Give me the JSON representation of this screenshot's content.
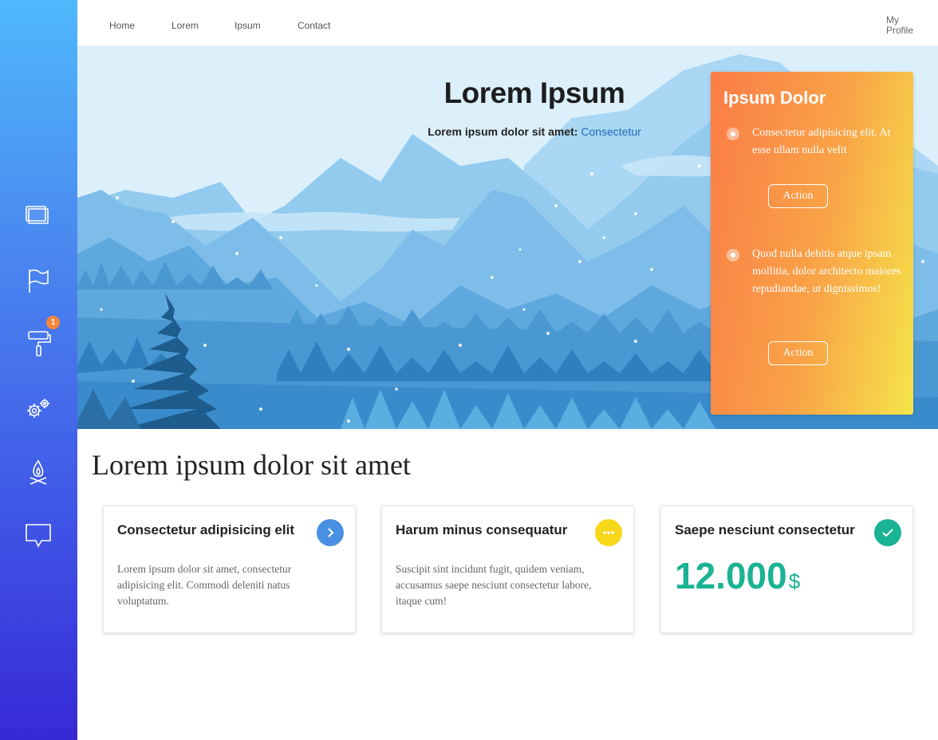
{
  "nav": {
    "links": [
      "Home",
      "Lorem",
      "Ipsum",
      "Contact"
    ],
    "profile": "My Profile"
  },
  "sidebar": {
    "items": [
      {
        "icon": "windows-icon"
      },
      {
        "icon": "flag-icon"
      },
      {
        "icon": "paint-roller-icon",
        "badge": "1"
      },
      {
        "icon": "gears-icon"
      },
      {
        "icon": "campfire-icon"
      },
      {
        "icon": "presentation-icon"
      }
    ]
  },
  "hero": {
    "title": "Lorem Ipsum",
    "subtitle_prefix": "Lorem ipsum dolor sit amet:",
    "subtitle_link": "Consectetur"
  },
  "panel": {
    "title": "Ipsum Dolor",
    "items": [
      {
        "text": "Consectetur adipisicing elit. At esse ullam nulla velit",
        "action": "Action"
      },
      {
        "text": "Quod nulla debitis atque ipsam mollitia, dolor architecto maiores repudiandae, ut dignissimos!",
        "action": "Action"
      }
    ]
  },
  "main": {
    "title": "Lorem ipsum dolor sit amet",
    "cards": [
      {
        "title": "Consectetur adipisicing elit",
        "icon": "chevron-right-icon",
        "color": "#4a90e2",
        "text": "Lorem ipsum dolor sit amet, consectetur adipisicing elit. Commodi deleniti natus voluptatum."
      },
      {
        "title": "Harum minus consequatur",
        "icon": "more-dots-icon",
        "color": "#f8d81b",
        "text": "Suscipit sint incidunt fugit, quidem veniam, accusamus saepe nesciunt consectetur labore, itaque cum!"
      },
      {
        "title": "Saepe nesciunt consectetur",
        "icon": "check-icon",
        "color": "#1ab394",
        "amount": "12.000",
        "currency": "$"
      }
    ]
  },
  "colors": {
    "sidebar_top": "#4fb8fb",
    "sidebar_bottom": "#3729d6",
    "accent_orange": "#fb7c47",
    "accent_yellow": "#f5e54a",
    "accent_green": "#1ab394"
  }
}
